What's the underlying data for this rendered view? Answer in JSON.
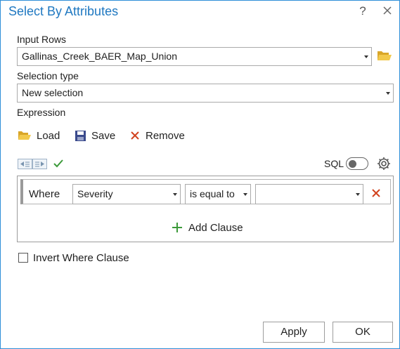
{
  "dialog": {
    "title": "Select By Attributes",
    "help_label": "?"
  },
  "input_rows": {
    "label": "Input Rows",
    "value": "Gallinas_Creek_BAER_Map_Union"
  },
  "selection_type": {
    "label": "Selection type",
    "value": "New selection"
  },
  "expression": {
    "label": "Expression",
    "toolbar": {
      "load_label": "Load",
      "save_label": "Save",
      "remove_label": "Remove"
    },
    "sql_label": "SQL",
    "sql_toggle_on": false,
    "clause": {
      "where_label": "Where",
      "field": "Severity",
      "operator": "is equal to",
      "value": ""
    },
    "add_clause_label": "Add Clause"
  },
  "invert": {
    "label": "Invert Where Clause",
    "checked": false
  },
  "buttons": {
    "apply_label": "Apply",
    "ok_label": "OK"
  },
  "colors": {
    "title": "#1f78c1",
    "folder": "#e7b536",
    "remove_x": "#d2421e",
    "add_plus": "#3c9a3a",
    "check": "#3c9a3a"
  }
}
